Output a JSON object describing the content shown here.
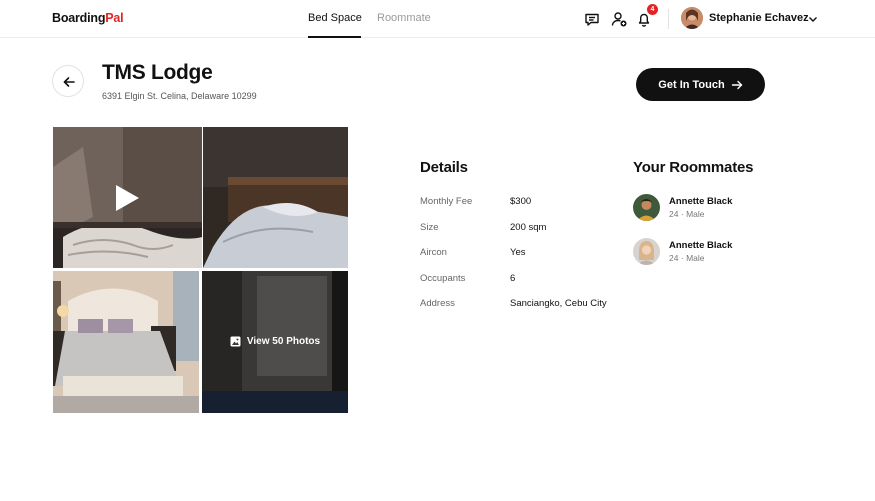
{
  "brand": {
    "name_part1": "Boarding",
    "name_part2": "Pal",
    "accent_color": "#e02424"
  },
  "nav": {
    "tabs": [
      {
        "label": "Bed Space",
        "active": true
      },
      {
        "label": "Roommate",
        "active": false
      }
    ]
  },
  "topbar": {
    "icons": [
      "chat-icon",
      "add-user-icon",
      "bell-icon"
    ],
    "notification_count": "4",
    "user_name": "Stephanie Echavez"
  },
  "listing": {
    "title": "TMS Lodge",
    "address": "6391 Elgin St. Celina, Delaware 10299",
    "cta_label": "Get In Touch",
    "view_photos_label": "View 50 Photos"
  },
  "details": {
    "title": "Details",
    "rows": [
      {
        "label": "Monthly Fee",
        "value": "$300"
      },
      {
        "label": "Size",
        "value": "200 sqm"
      },
      {
        "label": "Aircon",
        "value": "Yes"
      },
      {
        "label": "Occupants",
        "value": "6"
      },
      {
        "label": "Address",
        "value": "Sanciangko, Cebu City"
      }
    ]
  },
  "roommates": {
    "title": "Your Roommates",
    "items": [
      {
        "name": "Annette Black",
        "age": "24",
        "separator": "·",
        "gender": "Male"
      },
      {
        "name": "Annette Black",
        "age": "24",
        "separator": "·",
        "gender": "Male"
      }
    ]
  }
}
